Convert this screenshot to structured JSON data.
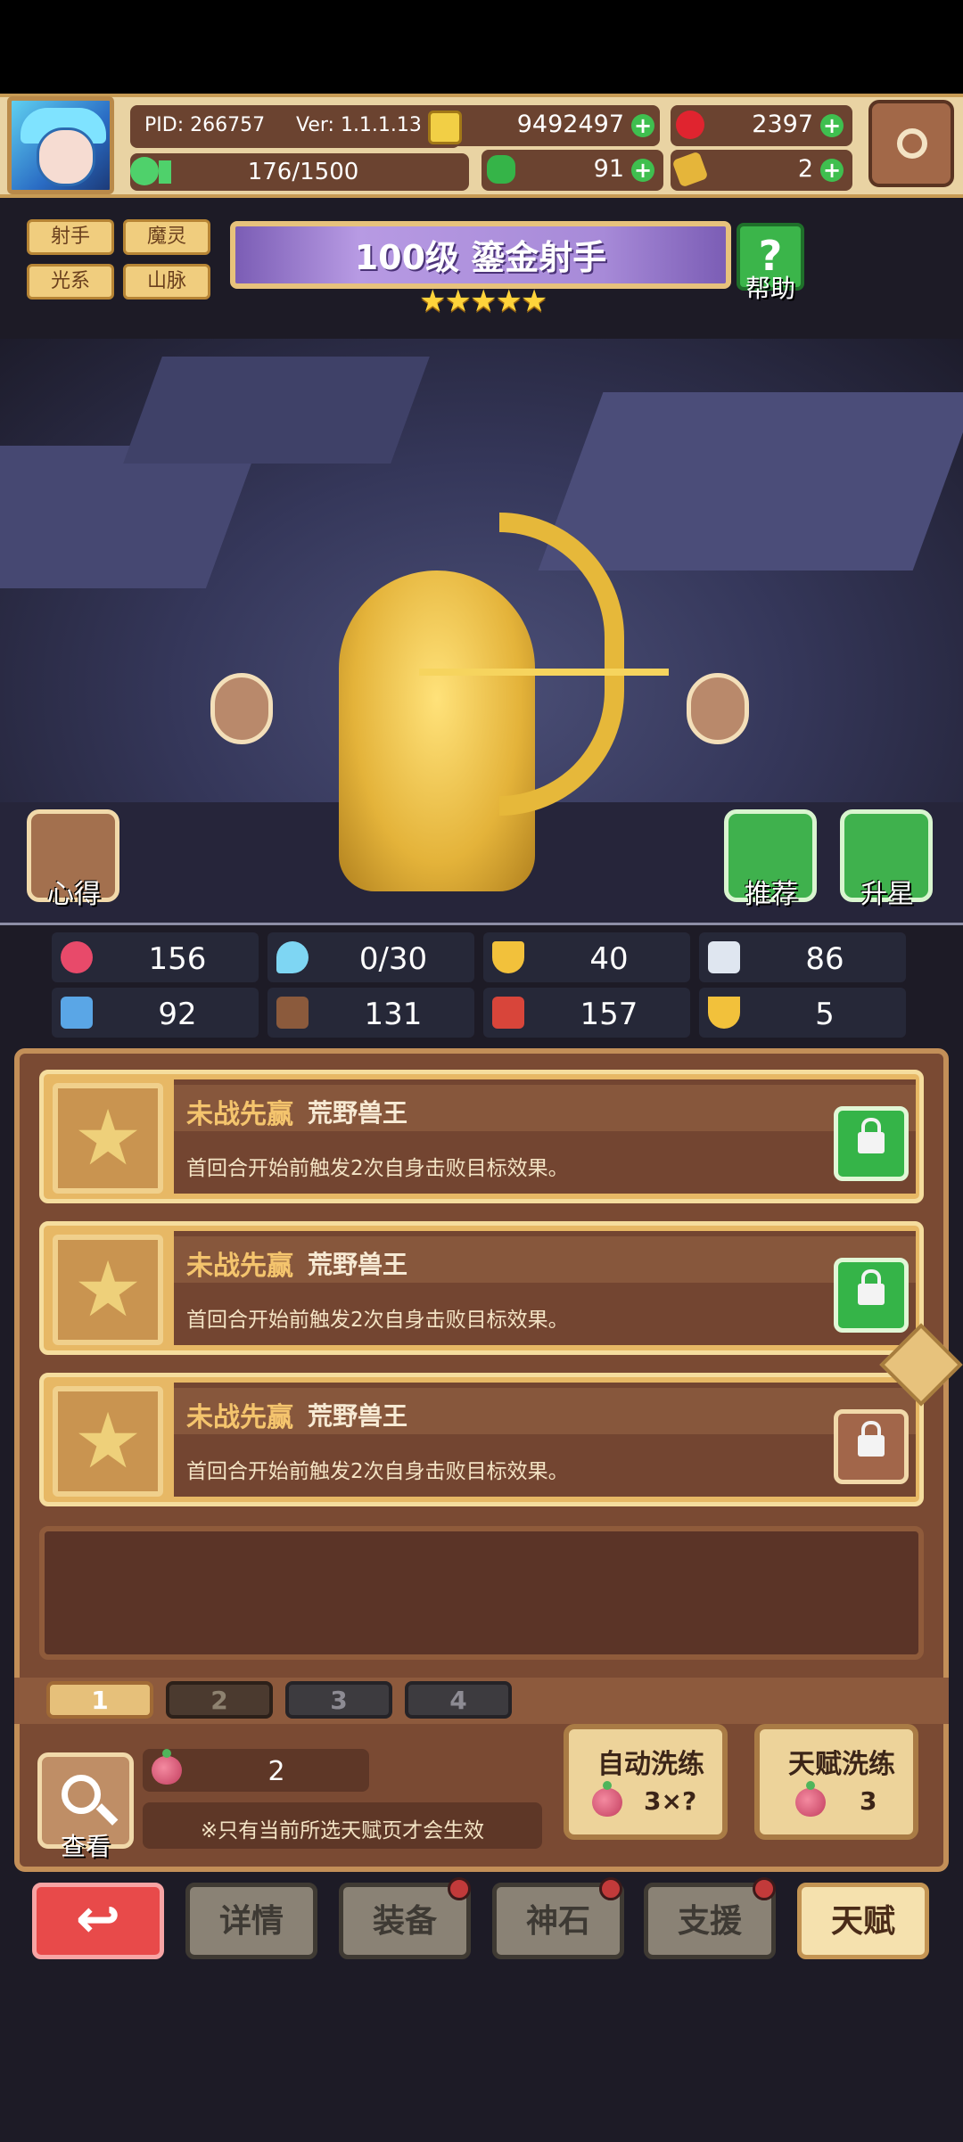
{
  "header": {
    "pid": "PID: 266757",
    "version": "Ver: 1.1.1.13",
    "gold": "9492497",
    "gems": "2397",
    "energy": "176/1500",
    "clover": "91",
    "key": "2"
  },
  "tags": [
    "射手",
    "魔灵",
    "光系",
    "山脉"
  ],
  "hero": {
    "title": "100级  鎏金射手",
    "stars": "★★★★★",
    "help_label": "帮助",
    "left_btn_label": "心得",
    "recommend_label": "推荐",
    "starup_label": "升星"
  },
  "stats": {
    "hp": "156",
    "mana": "0/30",
    "defense": "40",
    "speed": "86",
    "attack": "92",
    "magic": "131",
    "crit": "157",
    "luck": "5"
  },
  "talents": [
    {
      "name": "未战先赢",
      "kind": "荒野兽王",
      "desc": "首回合开始前触发2次自身击败目标效果。",
      "lock": "locked"
    },
    {
      "name": "未战先赢",
      "kind": "荒野兽王",
      "desc": "首回合开始前触发2次自身击败目标效果。",
      "lock": "locked"
    },
    {
      "name": "未战先赢",
      "kind": "荒野兽王",
      "desc": "首回合开始前触发2次自身击败目标效果。",
      "lock": "unlocked"
    }
  ],
  "pages": [
    "1",
    "2",
    "3",
    "4"
  ],
  "footer": {
    "view_label": "查看",
    "fruit_count": "2",
    "note": "※只有当前所选天赋页才会生效",
    "auto_refine_label": "自动洗练",
    "auto_refine_cost": "3×?",
    "talent_refine_label": "天赋洗练",
    "talent_refine_cost": "3"
  },
  "nav": {
    "back_icon": "↩",
    "details": "详情",
    "equipment": "装备",
    "godstone": "神石",
    "support": "支援",
    "talent": "天赋"
  },
  "colors": {
    "accent_gold": "#e7b865",
    "panel_brown": "#7a4a33",
    "green_button": "#3fb14d",
    "back_red": "#e84a4a"
  }
}
